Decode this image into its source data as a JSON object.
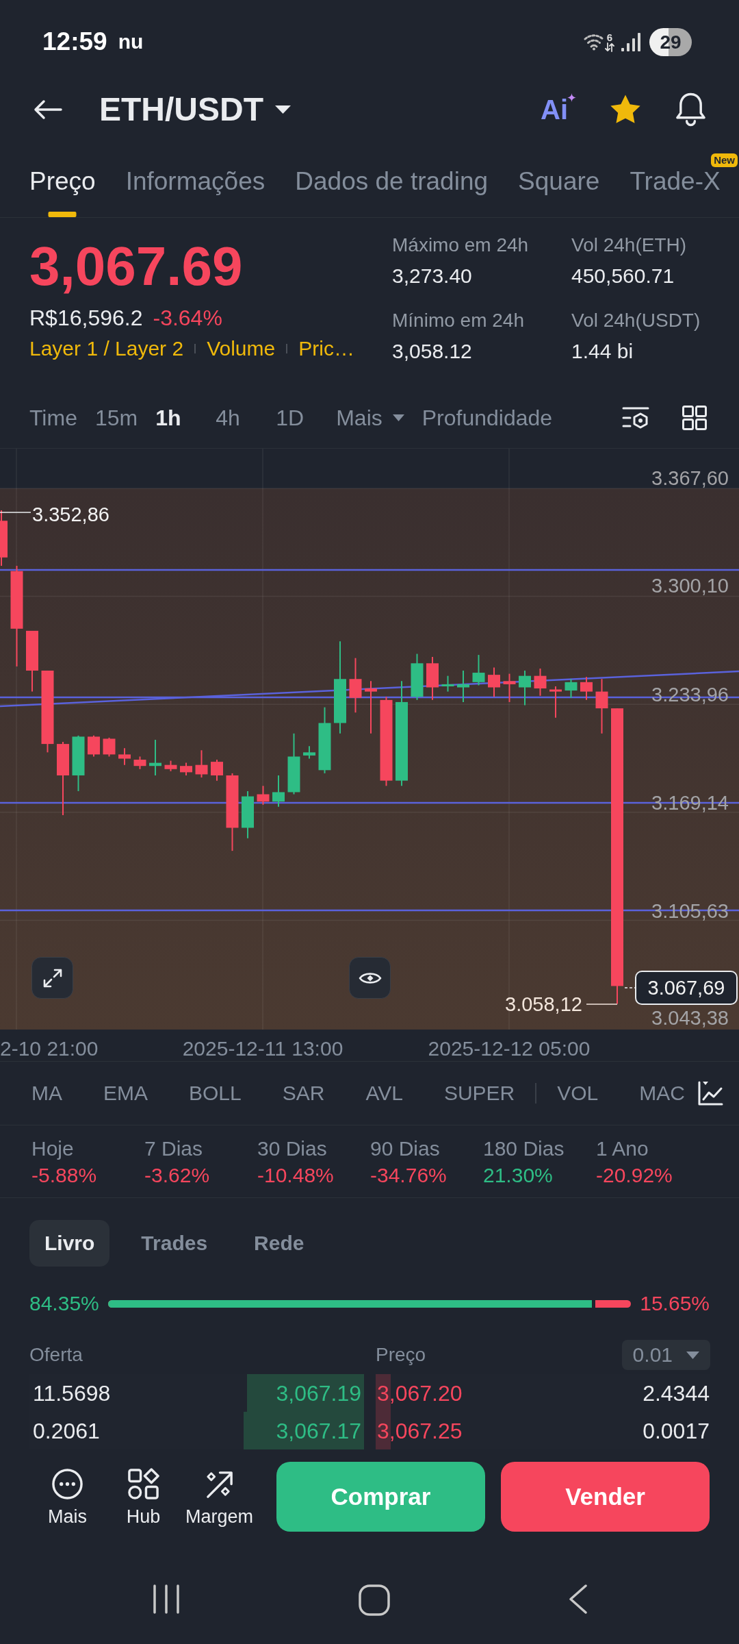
{
  "status_bar": {
    "time": "12:59",
    "notification": "nu",
    "wifi_label": "6",
    "battery": "29"
  },
  "header": {
    "title": "ETH/USDT",
    "ai_label": "Ai",
    "favorite": true
  },
  "tabs": [
    {
      "label": "Preço",
      "selected": true
    },
    {
      "label": "Informações",
      "selected": false
    },
    {
      "label": "Dados de trading",
      "selected": false
    },
    {
      "label": "Square",
      "selected": false
    },
    {
      "label": "Trade-X",
      "selected": false,
      "badge": "New"
    }
  ],
  "ticker": {
    "last_price": "3,067.69",
    "fiat_price": "R$16,596.2",
    "change": "-3.64%",
    "tags": [
      "Layer 1 / Layer 2",
      "Volume",
      "Pric…"
    ],
    "stats": [
      {
        "label": "Máximo em 24h",
        "value": "3,273.40"
      },
      {
        "label": "Vol 24h(ETH)",
        "value": "450,560.71"
      },
      {
        "label": "Mínimo em 24h",
        "value": "3,058.12"
      },
      {
        "label": "Vol 24h(USDT)",
        "value": "1.44 bi"
      }
    ]
  },
  "intervals": [
    {
      "label": "Time",
      "kind": "option",
      "selected": false
    },
    {
      "label": "15m",
      "kind": "option",
      "selected": false
    },
    {
      "label": "1h",
      "kind": "option",
      "selected": true
    },
    {
      "label": "4h",
      "kind": "option",
      "selected": false
    },
    {
      "label": "1D",
      "kind": "option",
      "selected": false
    },
    {
      "label": "Mais",
      "kind": "dropdown",
      "selected": false
    },
    {
      "label": "Profundidade",
      "kind": "option",
      "selected": false
    }
  ],
  "chart": {
    "price_axis": [
      "3.367,60",
      "3.300,10",
      "3.233,96",
      "3.169,14",
      "3.105,63",
      "3.043,38"
    ],
    "high_marker": "3.352,86",
    "low_marker": "3.058,12",
    "last_price_tag": "3.067,69",
    "time_axis": [
      "2-10 21:00",
      "2025-12-11 13:00",
      "2025-12-12 05:00"
    ]
  },
  "indicators": [
    {
      "label": "MA",
      "kind": "main"
    },
    {
      "label": "EMA",
      "kind": "main"
    },
    {
      "label": "BOLL",
      "kind": "main"
    },
    {
      "label": "SAR",
      "kind": "main"
    },
    {
      "label": "AVL",
      "kind": "main"
    },
    {
      "label": "SUPER",
      "kind": "main"
    },
    {
      "label": "VOL",
      "kind": "sub"
    },
    {
      "label": "MAC",
      "kind": "sub"
    }
  ],
  "performance": [
    {
      "label": "Hoje",
      "value": "-5.88%",
      "color": "#f6465d"
    },
    {
      "label": "7 Dias",
      "value": "-3.62%",
      "color": "#f6465d"
    },
    {
      "label": "30 Dias",
      "value": "-10.48%",
      "color": "#f6465d"
    },
    {
      "label": "90 Dias",
      "value": "-34.76%",
      "color": "#f6465d"
    },
    {
      "label": "180 Dias",
      "value": "21.30%",
      "color": "#2ebd85"
    },
    {
      "label": "1 Ano",
      "value": "-20.92%",
      "color": "#f6465d"
    }
  ],
  "order_book": {
    "tabs": [
      {
        "label": "Livro",
        "selected": true
      },
      {
        "label": "Trades",
        "selected": false
      },
      {
        "label": "Rede",
        "selected": false
      }
    ],
    "ratio": {
      "bid": "84.35%",
      "ask": "15.65%",
      "level": 0.925
    },
    "columns": [
      "Oferta",
      "Preço"
    ],
    "precision": "0.01",
    "rows": [
      {
        "bid_size": "11.5698",
        "bid_price": "3,067.19",
        "bid_depth": {
          "level": 0.35
        },
        "ask_price": "3,067.20",
        "ask_depth": {
          "level": 0.045
        },
        "ask_size": "2.4344"
      },
      {
        "bid_size": "0.2061",
        "bid_price": "3,067.17",
        "bid_depth": {
          "level": 0.36
        },
        "ask_price": "3,067.25",
        "ask_depth": {
          "level": 0.045
        },
        "ask_size": "0.0017"
      }
    ]
  },
  "actions": [
    {
      "label": "Mais",
      "kind": "more"
    },
    {
      "label": "Hub",
      "kind": "hub"
    },
    {
      "label": "Margem",
      "kind": "margin"
    }
  ],
  "trade_buttons": [
    {
      "label": "Comprar",
      "kind": "buy"
    },
    {
      "label": "Vender",
      "kind": "sell"
    }
  ]
}
